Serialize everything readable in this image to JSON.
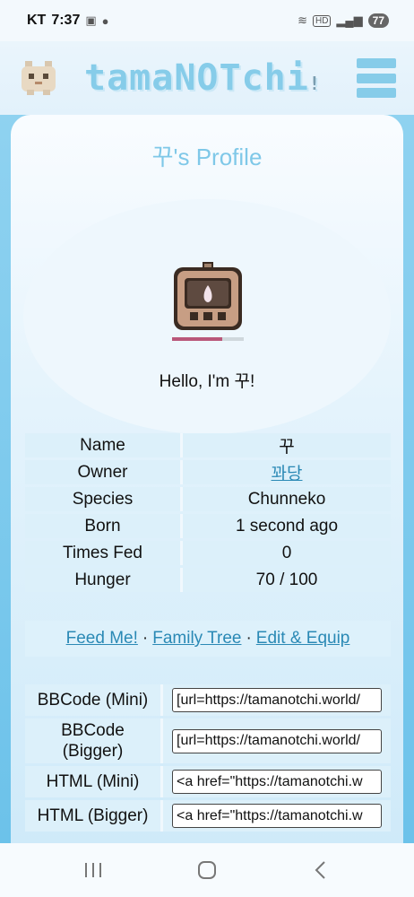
{
  "status_bar": {
    "carrier": "KT",
    "time": "7:37",
    "network_label": "HD",
    "battery": "77"
  },
  "header": {
    "logo_text": "tamaNOTchi",
    "logo_text_suffix": "!"
  },
  "profile": {
    "title": "꾸's Profile",
    "greeting": "Hello, I'm 꾸!"
  },
  "info_rows": [
    {
      "label": "Name",
      "value": "꾸"
    },
    {
      "label": "Owner",
      "value": "꽈당"
    },
    {
      "label": "Species",
      "value": "Chunneko"
    },
    {
      "label": "Born",
      "value": "1 second ago"
    },
    {
      "label": "Times Fed",
      "value": "0"
    },
    {
      "label": "Hunger",
      "value": "70 / 100"
    }
  ],
  "actions": {
    "feed": "Feed Me!",
    "family_tree": "Family Tree",
    "edit_equip": "Edit & Equip",
    "separator": "·"
  },
  "codes": [
    {
      "label": "BBCode (Mini)",
      "value": "[url=https://tamanotchi.world/"
    },
    {
      "label": "BBCode (Bigger)",
      "value": "[url=https://tamanotchi.world/"
    },
    {
      "label": "HTML (Mini)",
      "value": "<a href=\"https://tamanotchi.w"
    },
    {
      "label": "HTML (Bigger)",
      "value": "<a href=\"https://tamanotchi.w"
    }
  ],
  "pet": {
    "hunger_fraction": 0.7
  },
  "colors": {
    "accent": "#86cce9",
    "link": "#2a89b5",
    "row_bg": "#dcf0fa"
  }
}
